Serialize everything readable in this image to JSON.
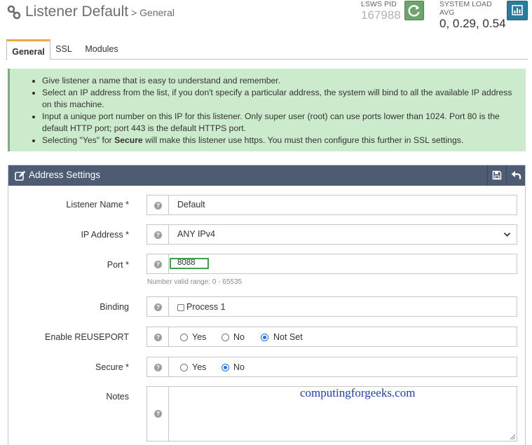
{
  "header": {
    "title": "Listener Default",
    "breadcrumb": "> General",
    "pid_label": "LSWS PID",
    "pid_value": "167988",
    "load_label": "SYSTEM LOAD AVG",
    "load_value": "0, 0.29, 0.54"
  },
  "tabs": [
    {
      "label": "General",
      "active": true
    },
    {
      "label": "SSL",
      "active": false
    },
    {
      "label": "Modules",
      "active": false
    }
  ],
  "info": {
    "items": [
      "Give listener a name that is easy to understand and remember.",
      "Select an IP address from the list, if you don't specify a particular address, the system will bind to all the available IP address on this machine.",
      "Input a unique port number on this IP for this listener. Only super user (root) can use ports lower than 1024. Port 80 is the default HTTP port; port 443 is the default HTTPS port."
    ],
    "secure_pre": "Selecting \"Yes\" for ",
    "secure_bold": "Secure",
    "secure_post": " will make this listener use https. You must then configure this further in SSL settings."
  },
  "panel": {
    "title": "Address Settings",
    "fields": {
      "listener_name": {
        "label": "Listener Name *",
        "value": "Default"
      },
      "ip_address": {
        "label": "IP Address *",
        "value": "ANY IPv4"
      },
      "port": {
        "label": "Port *",
        "value": "8088",
        "hint": "Number valid range: 0 - 65535"
      },
      "binding": {
        "label": "Binding",
        "option": "Process 1"
      },
      "reuseport": {
        "label": "Enable REUSEPORT",
        "options": [
          "Yes",
          "No",
          "Not Set"
        ],
        "selected": "Not Set"
      },
      "secure": {
        "label": "Secure *",
        "options": [
          "Yes",
          "No"
        ],
        "selected": "No"
      },
      "notes": {
        "label": "Notes",
        "value": ""
      }
    }
  },
  "watermark": "computingforgeeks.com",
  "colors": {
    "panel_header": "#4d5b73",
    "info_bg": "#ccebcc",
    "refresh_btn": "#6da46b",
    "stats_btn": "#2b7b9b",
    "tab_accent": "#f0a83b"
  }
}
